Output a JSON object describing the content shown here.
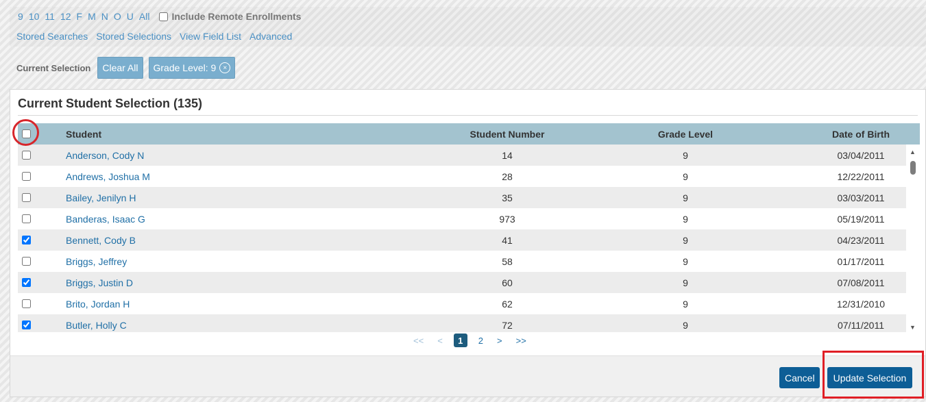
{
  "filters": {
    "alpha_links": [
      "9",
      "10",
      "11",
      "12",
      "F",
      "M",
      "N",
      "O",
      "U",
      "All"
    ],
    "include_remote_label": "Include Remote Enrollments",
    "include_remote_checked": false,
    "links": [
      "Stored Searches",
      "Stored Selections",
      "View Field List",
      "Advanced"
    ]
  },
  "current_selection": {
    "label": "Current Selection",
    "clear_all": "Clear All",
    "chip": "Grade Level: 9",
    "chip_remove": "×"
  },
  "dialog": {
    "title": "Current Student Selection (135)",
    "columns": {
      "student": "Student",
      "number": "Student Number",
      "grade": "Grade Level",
      "dob": "Date of Birth"
    },
    "select_all_checked": false,
    "rows": [
      {
        "name": "Anderson, Cody N",
        "number": "14",
        "grade": "9",
        "dob": "03/04/2011",
        "checked": false
      },
      {
        "name": "Andrews, Joshua M",
        "number": "28",
        "grade": "9",
        "dob": "12/22/2011",
        "checked": false
      },
      {
        "name": "Bailey, Jenilyn H",
        "number": "35",
        "grade": "9",
        "dob": "03/03/2011",
        "checked": false
      },
      {
        "name": "Banderas, Isaac G",
        "number": "973",
        "grade": "9",
        "dob": "05/19/2011",
        "checked": false
      },
      {
        "name": "Bennett, Cody B",
        "number": "41",
        "grade": "9",
        "dob": "04/23/2011",
        "checked": true
      },
      {
        "name": "Briggs, Jeffrey",
        "number": "58",
        "grade": "9",
        "dob": "01/17/2011",
        "checked": false
      },
      {
        "name": "Briggs, Justin D",
        "number": "60",
        "grade": "9",
        "dob": "07/08/2011",
        "checked": true
      },
      {
        "name": "Brito, Jordan H",
        "number": "62",
        "grade": "9",
        "dob": "12/31/2010",
        "checked": false
      },
      {
        "name": "Butler, Holly C",
        "number": "72",
        "grade": "9",
        "dob": "07/11/2011",
        "checked": true
      }
    ],
    "pagination": {
      "first": "<<",
      "prev": "<",
      "pages": [
        "1",
        "2"
      ],
      "current": "1",
      "next": ">",
      "last": ">>"
    },
    "buttons": {
      "cancel": "Cancel",
      "update": "Update Selection"
    }
  },
  "icons": {
    "scroll_up": "triangle-up",
    "scroll_down": "triangle-down",
    "remove": "circle-x"
  },
  "colors": {
    "accent": "#0d5e96",
    "highlight": "#d7262b",
    "header_bg": "#a3c3cf",
    "link": "#1f6fa6"
  }
}
